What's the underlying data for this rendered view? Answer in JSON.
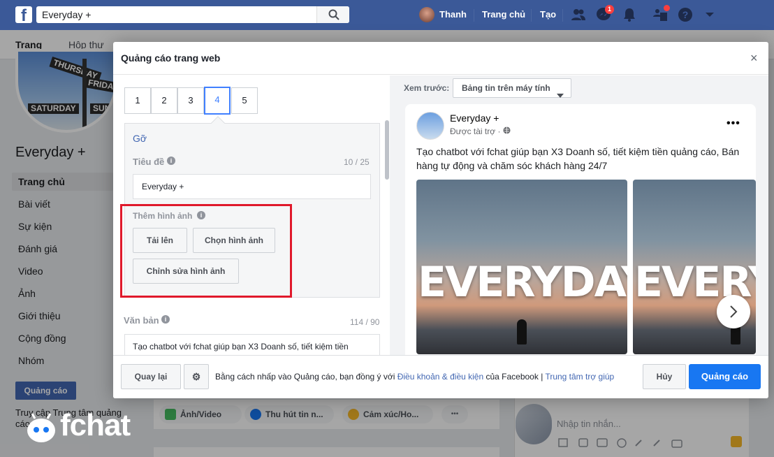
{
  "topbar": {
    "logo": "f",
    "search_value": "Everyday +",
    "user_name": "Thanh",
    "home_label": "Trang chủ",
    "create_label": "Tạo",
    "messenger_badge": "1"
  },
  "page": {
    "tabs": [
      "Trang",
      "Hộp thư"
    ],
    "name": "Everyday +",
    "cover_signs": [
      "THURSDAY",
      "FRIDA",
      "SATURDAY",
      "SUN"
    ],
    "sidebar": [
      "Trang chủ",
      "Bài viết",
      "Sự kiện",
      "Đánh giá",
      "Video",
      "Ảnh",
      "Giới thiệu",
      "Cộng đồng",
      "Nhóm"
    ],
    "ad_button": "Quảng cáo",
    "help_text": "Truy cập Trung tâm quảng cáo",
    "composer": [
      "Ảnh/Video",
      "Thu hút tin n...",
      "Cảm xúc/Ho..."
    ],
    "composer_more": "•••",
    "chat_placeholder": "Nhập tin nhắn...",
    "watermark": "fchat"
  },
  "modal": {
    "title": "Quảng cáo trang web",
    "close": "×",
    "steps": [
      "1",
      "2",
      "3",
      "4",
      "5"
    ],
    "active_step": 4,
    "remove_link": "Gỡ",
    "title_label": "Tiêu đề",
    "title_count": "10 / 25",
    "title_value": "Everyday +",
    "image_label": "Thêm hình ảnh",
    "upload_btn": "Tải lên",
    "choose_btn": "Chọn hình ảnh",
    "edit_btn": "Chỉnh sửa hình ảnh",
    "text_label": "Văn bản",
    "text_count": "114 / 90",
    "text_value": "Tạo chatbot với fchat giúp bạn X3 Doanh số, tiết kiệm tiền quảng cáo, Bán hàng tự động và chăm sóc khách hàng 24/7",
    "preview_label": "Xem trước:",
    "preview_select": "Bảng tin trên máy tính",
    "post": {
      "name": "Everyday +",
      "sponsored": "Được tài trợ · ",
      "more": "•••",
      "text": "Tạo chatbot với fchat giúp bạn X3 Doanh số, tiết kiệm tiền quảng cáo, Bán hàng tự động và chăm sóc khách hàng 24/7",
      "carousel_word_1": "EVERYDAY",
      "carousel_word_2": "EVERY"
    },
    "footer": {
      "back": "Quay lại",
      "gear": "⚙",
      "text_before": "Bằng cách nhấp vào Quảng cáo, bạn đồng ý với ",
      "terms_link": "Điều khoản & điều kiện",
      "text_after": " của Facebook  |  ",
      "help_link": "Trung tâm trợ giúp",
      "cancel": "Hủy",
      "submit": "Quảng cáo"
    }
  },
  "colors": {
    "fb_blue": "#3b5998",
    "primary": "#1877f2",
    "highlight_red": "#e0192b"
  }
}
